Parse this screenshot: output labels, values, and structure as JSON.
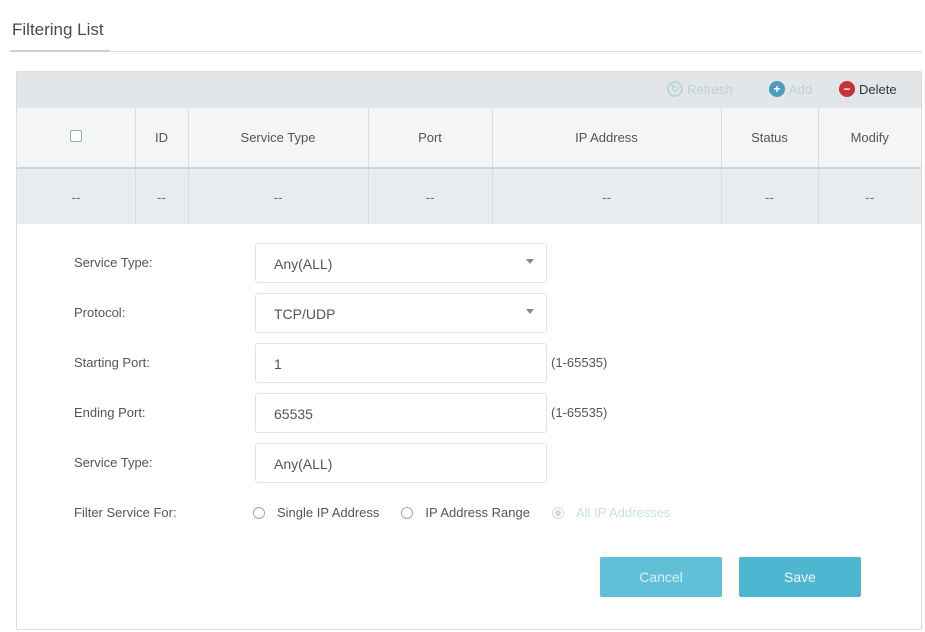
{
  "header": {
    "title": "Filtering List"
  },
  "toolbar": {
    "refresh_label": "Refresh",
    "add_label": "Add",
    "delete_label": "Delete",
    "refresh_icon": "refresh-icon",
    "add_icon": "plus-circle-icon",
    "delete_icon": "minus-circle-icon"
  },
  "table": {
    "columns": [
      "",
      "ID",
      "Service Type",
      "Port",
      "IP Address",
      "Status",
      "Modify"
    ],
    "rows": [
      [
        "--",
        "--",
        "--",
        "--",
        "--",
        "--",
        "--"
      ]
    ]
  },
  "form": {
    "service_type": {
      "label": "Service Type:",
      "value": "Any(ALL)"
    },
    "protocol": {
      "label": "Protocol:",
      "value": "TCP/UDP"
    },
    "starting_port": {
      "label": "Starting Port:",
      "value": "1",
      "hint": "(1-65535)"
    },
    "ending_port": {
      "label": "Ending Port:",
      "value": "65535",
      "hint": "(1-65535)"
    },
    "service_type_2": {
      "label": "Service Type:",
      "value": "Any(ALL)"
    },
    "filter_service_for": {
      "label": "Filter Service For:",
      "options": [
        "Single IP Address",
        "IP Address Range",
        "All IP Addresses"
      ],
      "selected": "All IP Addresses"
    },
    "cancel_label": "Cancel",
    "save_label": "Save"
  },
  "colors": {
    "accent": "#4fb6d2",
    "delete": "#c8303c",
    "toolbar_bg": "#e3e6e8"
  }
}
